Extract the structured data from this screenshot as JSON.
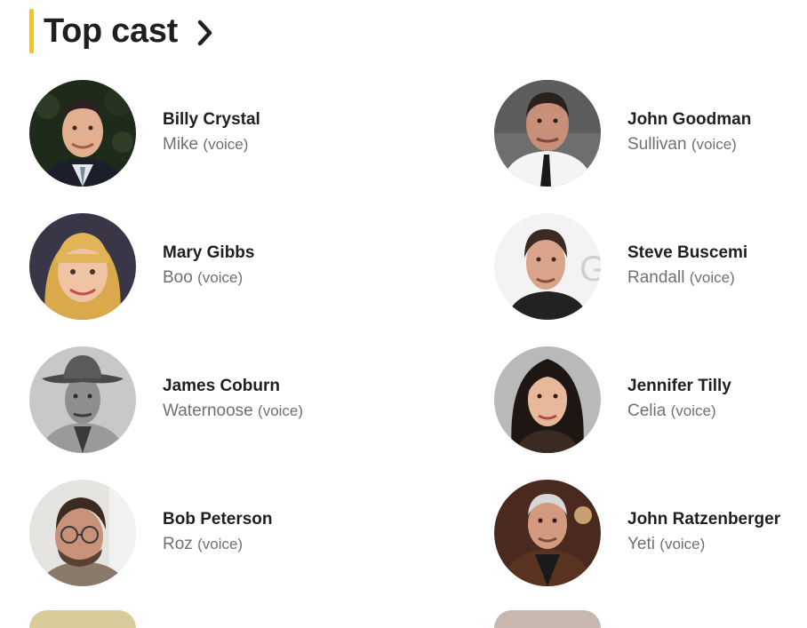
{
  "section": {
    "title": "Top cast",
    "accent_color": "#f5c518",
    "link_icon": "chevron-right-icon"
  },
  "cast": [
    {
      "name": "Billy Crystal",
      "character": "Mike",
      "note": "(voice)",
      "photo": "actor-photo-billy-crystal"
    },
    {
      "name": "John Goodman",
      "character": "Sullivan",
      "note": "(voice)",
      "photo": "actor-photo-john-goodman"
    },
    {
      "name": "Mary Gibbs",
      "character": "Boo",
      "note": "(voice)",
      "photo": "actor-photo-mary-gibbs"
    },
    {
      "name": "Steve Buscemi",
      "character": "Randall",
      "note": "(voice)",
      "photo": "actor-photo-steve-buscemi"
    },
    {
      "name": "James Coburn",
      "character": "Waternoose",
      "note": "(voice)",
      "photo": "actor-photo-james-coburn"
    },
    {
      "name": "Jennifer Tilly",
      "character": "Celia",
      "note": "(voice)",
      "photo": "actor-photo-jennifer-tilly"
    },
    {
      "name": "Bob Peterson",
      "character": "Roz",
      "note": "(voice)",
      "photo": "actor-photo-bob-peterson"
    },
    {
      "name": "John Ratzenberger",
      "character": "Yeti",
      "note": "(voice)",
      "photo": "actor-photo-john-ratzenberger"
    }
  ],
  "colors": {
    "name_text": "#1f1f1f",
    "character_text": "#707070"
  }
}
